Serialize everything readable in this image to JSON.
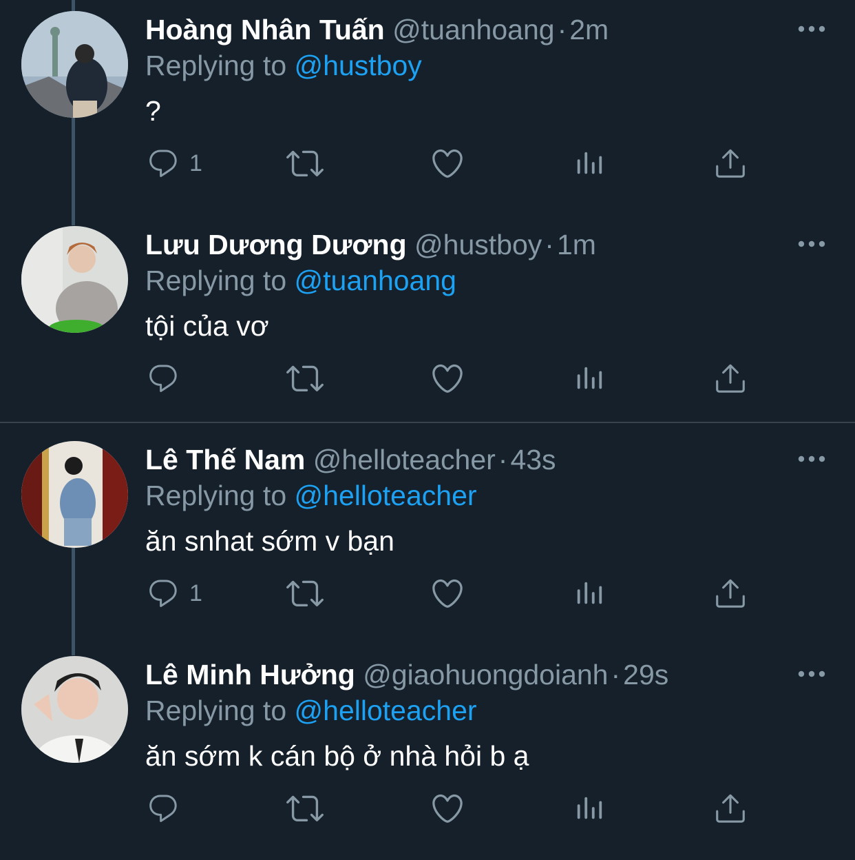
{
  "theme": {
    "background": "#15202b",
    "text_primary": "#ffffff",
    "text_secondary": "#8899a6",
    "accent": "#1da1f2",
    "divider": "#38444d",
    "thread_line": "#3d5466"
  },
  "icons": {
    "more": "more-horizontal-icon",
    "reply": "speech-bubble-icon",
    "retweet": "retweet-arrows-icon",
    "like": "heart-icon",
    "views": "bar-chart-icon",
    "share": "upload-arrow-icon"
  },
  "tweets": [
    {
      "name": "Hoàng Nhân Tuấn",
      "handle": "@tuanhoang",
      "separator": "·",
      "time": "2m",
      "replying_prefix": "Replying to",
      "replying_to": "@hustboy",
      "text": "?",
      "reply_count": "1"
    },
    {
      "name": "Lưu Dương Dương",
      "handle": "@hustboy",
      "separator": "·",
      "time": "1m",
      "replying_prefix": "Replying to",
      "replying_to": "@tuanhoang",
      "text": "tội của vơ",
      "reply_count": ""
    },
    {
      "name": "Lê Thế Nam",
      "handle": "@helloteacher",
      "separator": "·",
      "time": "43s",
      "replying_prefix": "Replying to",
      "replying_to": "@helloteacher",
      "text": "ăn snhat sớm v bạn",
      "reply_count": "1"
    },
    {
      "name": "Lê Minh Hưởng",
      "handle": "@giaohuongdoianh",
      "separator": "·",
      "time": "29s",
      "replying_prefix": "Replying to",
      "replying_to": "@helloteacher",
      "text": "ăn sớm k cán bộ ở nhà hỏi b ạ",
      "reply_count": ""
    }
  ]
}
